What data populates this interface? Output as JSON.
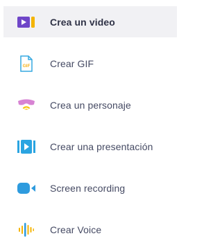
{
  "menu": {
    "items": [
      {
        "label": "Crea un video",
        "icon": "video-camera-icon",
        "active": true,
        "color": "#6f46c8"
      },
      {
        "label": "Crear GIF",
        "icon": "gif-file-icon",
        "active": false,
        "color": "#35a8e0"
      },
      {
        "label": "Crea un personaje",
        "icon": "character-sunglasses-icon",
        "active": false,
        "color": "#d783d3"
      },
      {
        "label": "Crear una presentación",
        "icon": "presentation-play-icon",
        "active": false,
        "color": "#2aa4e1"
      },
      {
        "label": "Screen recording",
        "icon": "screen-recording-camera-icon",
        "active": false,
        "color": "#2e9bde"
      },
      {
        "label": "Crear Voice",
        "icon": "voice-waveform-icon",
        "active": false,
        "color": "#f5b300"
      }
    ],
    "gif_icon_text": "GIF"
  }
}
